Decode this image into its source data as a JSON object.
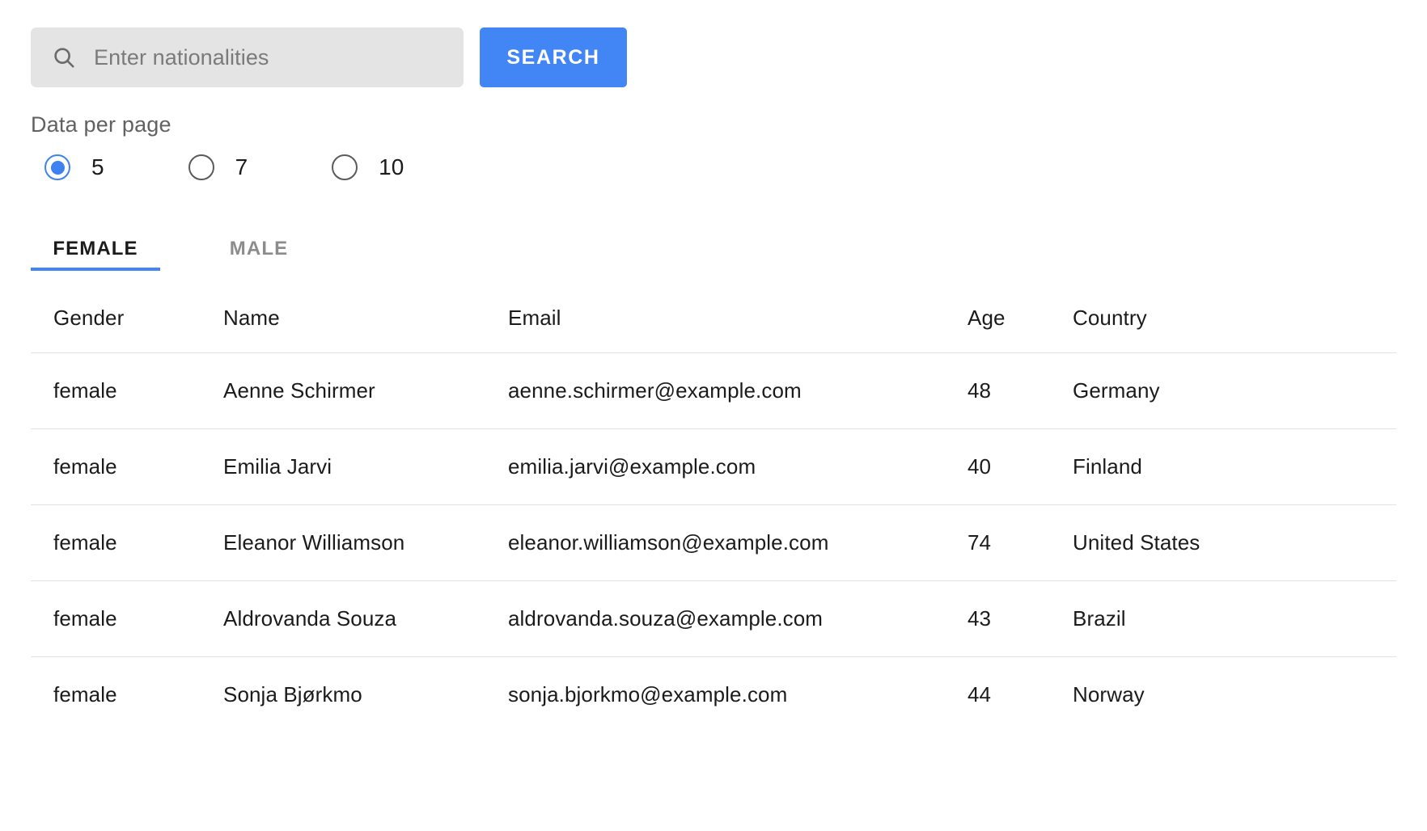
{
  "search": {
    "placeholder": "Enter nationalities",
    "value": "",
    "icon": "search-icon",
    "button_label": "SEARCH",
    "button_color": "#4285f4",
    "field_background": "#e4e4e4"
  },
  "data_per_page": {
    "label": "Data per page",
    "selected": "5",
    "options": [
      {
        "label": "5",
        "checked": true
      },
      {
        "label": "7",
        "checked": false
      },
      {
        "label": "10",
        "checked": false
      }
    ],
    "accent_color": "#3d82f0"
  },
  "tabs": {
    "active": "FEMALE",
    "items": [
      {
        "label": "FEMALE",
        "active": true
      },
      {
        "label": "MALE",
        "active": false
      }
    ],
    "indicator_color": "#4285f4"
  },
  "table": {
    "columns": [
      "Gender",
      "Name",
      "Email",
      "Age",
      "Country"
    ],
    "rows": [
      {
        "gender": "female",
        "name": "Aenne Schirmer",
        "email": "aenne.schirmer@example.com",
        "age": "48",
        "country": "Germany"
      },
      {
        "gender": "female",
        "name": "Emilia Jarvi",
        "email": "emilia.jarvi@example.com",
        "age": "40",
        "country": "Finland"
      },
      {
        "gender": "female",
        "name": "Eleanor Williamson",
        "email": "eleanor.williamson@example.com",
        "age": "74",
        "country": "United States"
      },
      {
        "gender": "female",
        "name": "Aldrovanda Souza",
        "email": "aldrovanda.souza@example.com",
        "age": "43",
        "country": "Brazil"
      },
      {
        "gender": "female",
        "name": "Sonja Bjørkmo",
        "email": "sonja.bjorkmo@example.com",
        "age": "44",
        "country": "Norway"
      }
    ]
  }
}
